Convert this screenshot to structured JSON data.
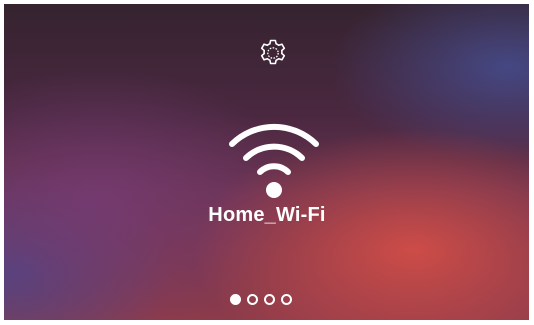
{
  "gear_icon": "gear-icon",
  "wifi_icon": "wifi-icon",
  "network": {
    "name": "Home_Wi-Fi"
  },
  "pager": {
    "page_count": 4,
    "active_page": 1
  },
  "colors": {
    "foreground": "#ffffff",
    "frame": "#ffffff"
  }
}
